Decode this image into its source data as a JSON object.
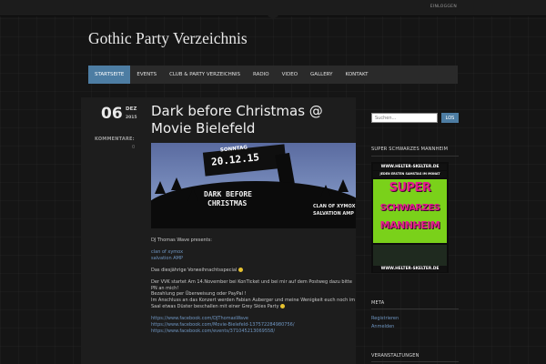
{
  "header": {
    "login": "EINLOGGEN",
    "site_title": "Gothic Party Verzeichnis"
  },
  "nav": [
    {
      "label": "STARTSEITE",
      "active": true
    },
    {
      "label": "EVENTS",
      "active": false
    },
    {
      "label": "CLUB & PARTY VERZEICHNIS",
      "active": false
    },
    {
      "label": "RADIO",
      "active": false
    },
    {
      "label": "VIDEO",
      "active": false
    },
    {
      "label": "GALLERY",
      "active": false
    },
    {
      "label": "KONTAKT",
      "active": false
    }
  ],
  "post": {
    "day": "06",
    "month": "DEZ",
    "year": "2015",
    "comments_label": "KOMMENTARE:",
    "comments_count": "0",
    "title": "Dark before Christmas @ Movie Bielefeld",
    "image": {
      "sonntag": "SONNTAG",
      "date": "20.12.15",
      "line1": "DARK BEFORE",
      "line2": "CHRISTMAS",
      "clan": "CLAN OF XYMOX",
      "salvation": "SALVATION AMP"
    },
    "presents": "DJ Thomas Wave presents:",
    "act1": "clan of xymox",
    "act2": "salvation AMP",
    "special": "Das diesjährige Vorweihnachtsspecial",
    "vvk1": "Der VVK startet Am 14.November bei KonTicket und bei mir auf dem Postweg dazu bitte PN an mich!",
    "vvk2": "Bezahlung per Überweisung oder PayPal !",
    "vvk3": "Im Anschluss an das Konzert werden Fabian Auberger und meine Wenigkeit euch noch im Saal etwas Düster beschallen mit einer Grey Skies Party",
    "link1": "https://www.facebook.com/DJThomasWave",
    "link2": "https://www.facebook.com/Movie-Bielefeld-137572284980756/",
    "link3": "https://www.facebook.com/events/371045213069558/"
  },
  "sidebar": {
    "search_placeholder": "Suchen...",
    "search_button": "LOS",
    "widget1_title": "SUPER SCHWARZES MANNHEIM",
    "poster": {
      "url_top": "WWW.HELTER-SKELTER.DE",
      "subtitle": "JEDEN ERSTEN SAMSTAG IM MONAT",
      "word1": "SUPER",
      "word2": "SCHWARZES",
      "word3": "MANNHEIM",
      "url_bottom": "WWW.HELTER-SKELTER.DE"
    },
    "meta_title": "META",
    "meta_links": [
      "Registrieren",
      "Anmelden"
    ],
    "events_title": "VERANSTALTUNGEN"
  }
}
